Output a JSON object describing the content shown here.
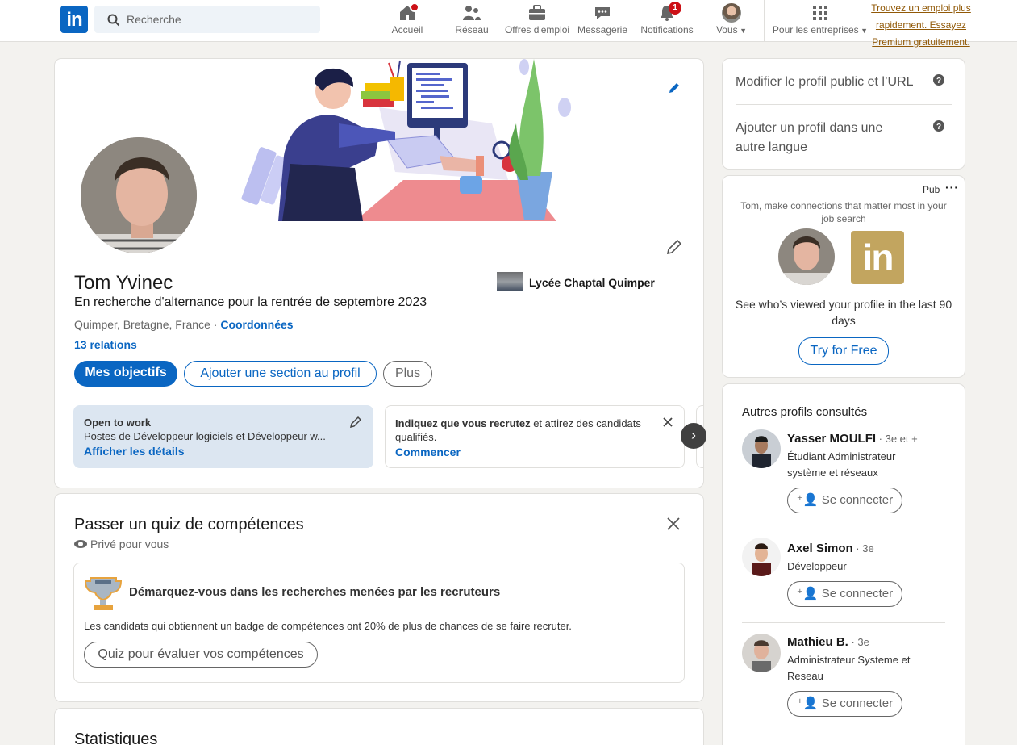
{
  "nav": {
    "search_placeholder": "Recherche",
    "items": [
      {
        "label": "Accueil",
        "icon": "home-icon"
      },
      {
        "label": "Réseau",
        "icon": "network-icon"
      },
      {
        "label": "Offres d'emploi",
        "icon": "briefcase-icon"
      },
      {
        "label": "Messagerie",
        "icon": "messaging-icon"
      },
      {
        "label": "Notifications",
        "icon": "bell-icon",
        "badge": "1"
      },
      {
        "label": "Vous",
        "icon": "avatar"
      },
      {
        "label": "Pour les entreprises",
        "icon": "grid-icon"
      }
    ],
    "premium_text": "Trouvez un emploi plus rapidement. Essayez Premium gratuitement."
  },
  "profile": {
    "name": "Tom Yvinec",
    "headline": "En recherche d'alternance pour la rentrée de septembre 2023",
    "location": "Quimper, Bretagne, France",
    "location_sep": " · ",
    "contact_link": "Coordonnées",
    "connections": "13 relations",
    "school": "Lycée Chaptal Quimper",
    "buttons": {
      "objectives": "Mes objectifs",
      "add_section": "Ajouter une section au profil",
      "more": "Plus"
    },
    "open_to_work": {
      "title": "Open to work",
      "desc": "Postes de Développeur logiciels et Développeur w...",
      "link": "Afficher les détails"
    },
    "hiring": {
      "bold": "Indiquez que vous recrutez",
      "rest": " et attirez des candidats",
      "line2": "qualifiés.",
      "link": "Commencer"
    }
  },
  "quiz": {
    "title": "Passer un quiz de compétences",
    "privacy": "Privé pour vous",
    "heading": "Démarquez-vous dans les recherches menées par les recruteurs",
    "desc": "Les candidats qui obtiennent un badge de compétences ont 20% de plus de chances de se faire recruter.",
    "button": "Quiz pour évaluer vos compétences"
  },
  "stats": {
    "title": "Statistiques"
  },
  "sidebar": {
    "public_profile": "Modifier le profil public et l’URL",
    "other_lang_1": "Ajouter un profil dans une",
    "other_lang_2": "autre langue"
  },
  "ad": {
    "label": "Pub",
    "intro": "Tom, make connections that matter most in your job search",
    "body": "See who’s viewed your profile in the last 90 days",
    "button": "Try for Free"
  },
  "others": {
    "title": "Autres profils consultés",
    "connect_label": "Se connecter",
    "people": [
      {
        "name": "Yasser MOULFI",
        "degree": " · 3e et +",
        "line1": "Étudiant Administrateur",
        "line2": "système et réseaux"
      },
      {
        "name": "Axel Simon",
        "degree": " · 3e",
        "line1": "Développeur",
        "line2": ""
      },
      {
        "name": "Mathieu B.",
        "degree": " · 3e",
        "line1": "Administrateur Systeme et",
        "line2": "Reseau"
      }
    ]
  },
  "colors": {
    "brand": "#0a66c2",
    "premium": "#915907",
    "badge": "#cc1016"
  }
}
